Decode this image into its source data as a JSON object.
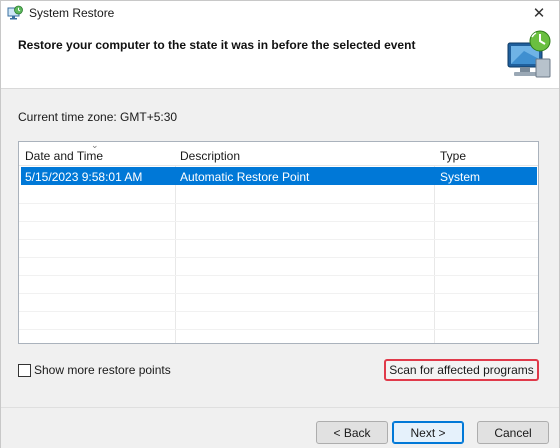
{
  "window": {
    "title": "System Restore",
    "close_glyph": "✕",
    "icon": "system-restore-icon"
  },
  "header": {
    "heading": "Restore your computer to the state it was in before the selected event",
    "icon": "system-restore-monitor-icon"
  },
  "timezone": {
    "label": "Current time zone: GMT+5:30"
  },
  "list": {
    "columns": [
      "Date and Time",
      "Description",
      "Type"
    ],
    "sort_indicator": "⌄",
    "rows": [
      {
        "date": "5/15/2023 9:58:01 AM",
        "description": "Automatic Restore Point",
        "type": "System",
        "selected": true
      }
    ]
  },
  "options": {
    "show_more_label": "Show more restore points",
    "show_more_checked": false
  },
  "buttons": {
    "scan": "Scan for affected programs",
    "back": "< Back",
    "next": "Next >",
    "cancel": "Cancel"
  },
  "colors": {
    "selection": "#0078d7",
    "highlight_border": "#e03a4a"
  }
}
